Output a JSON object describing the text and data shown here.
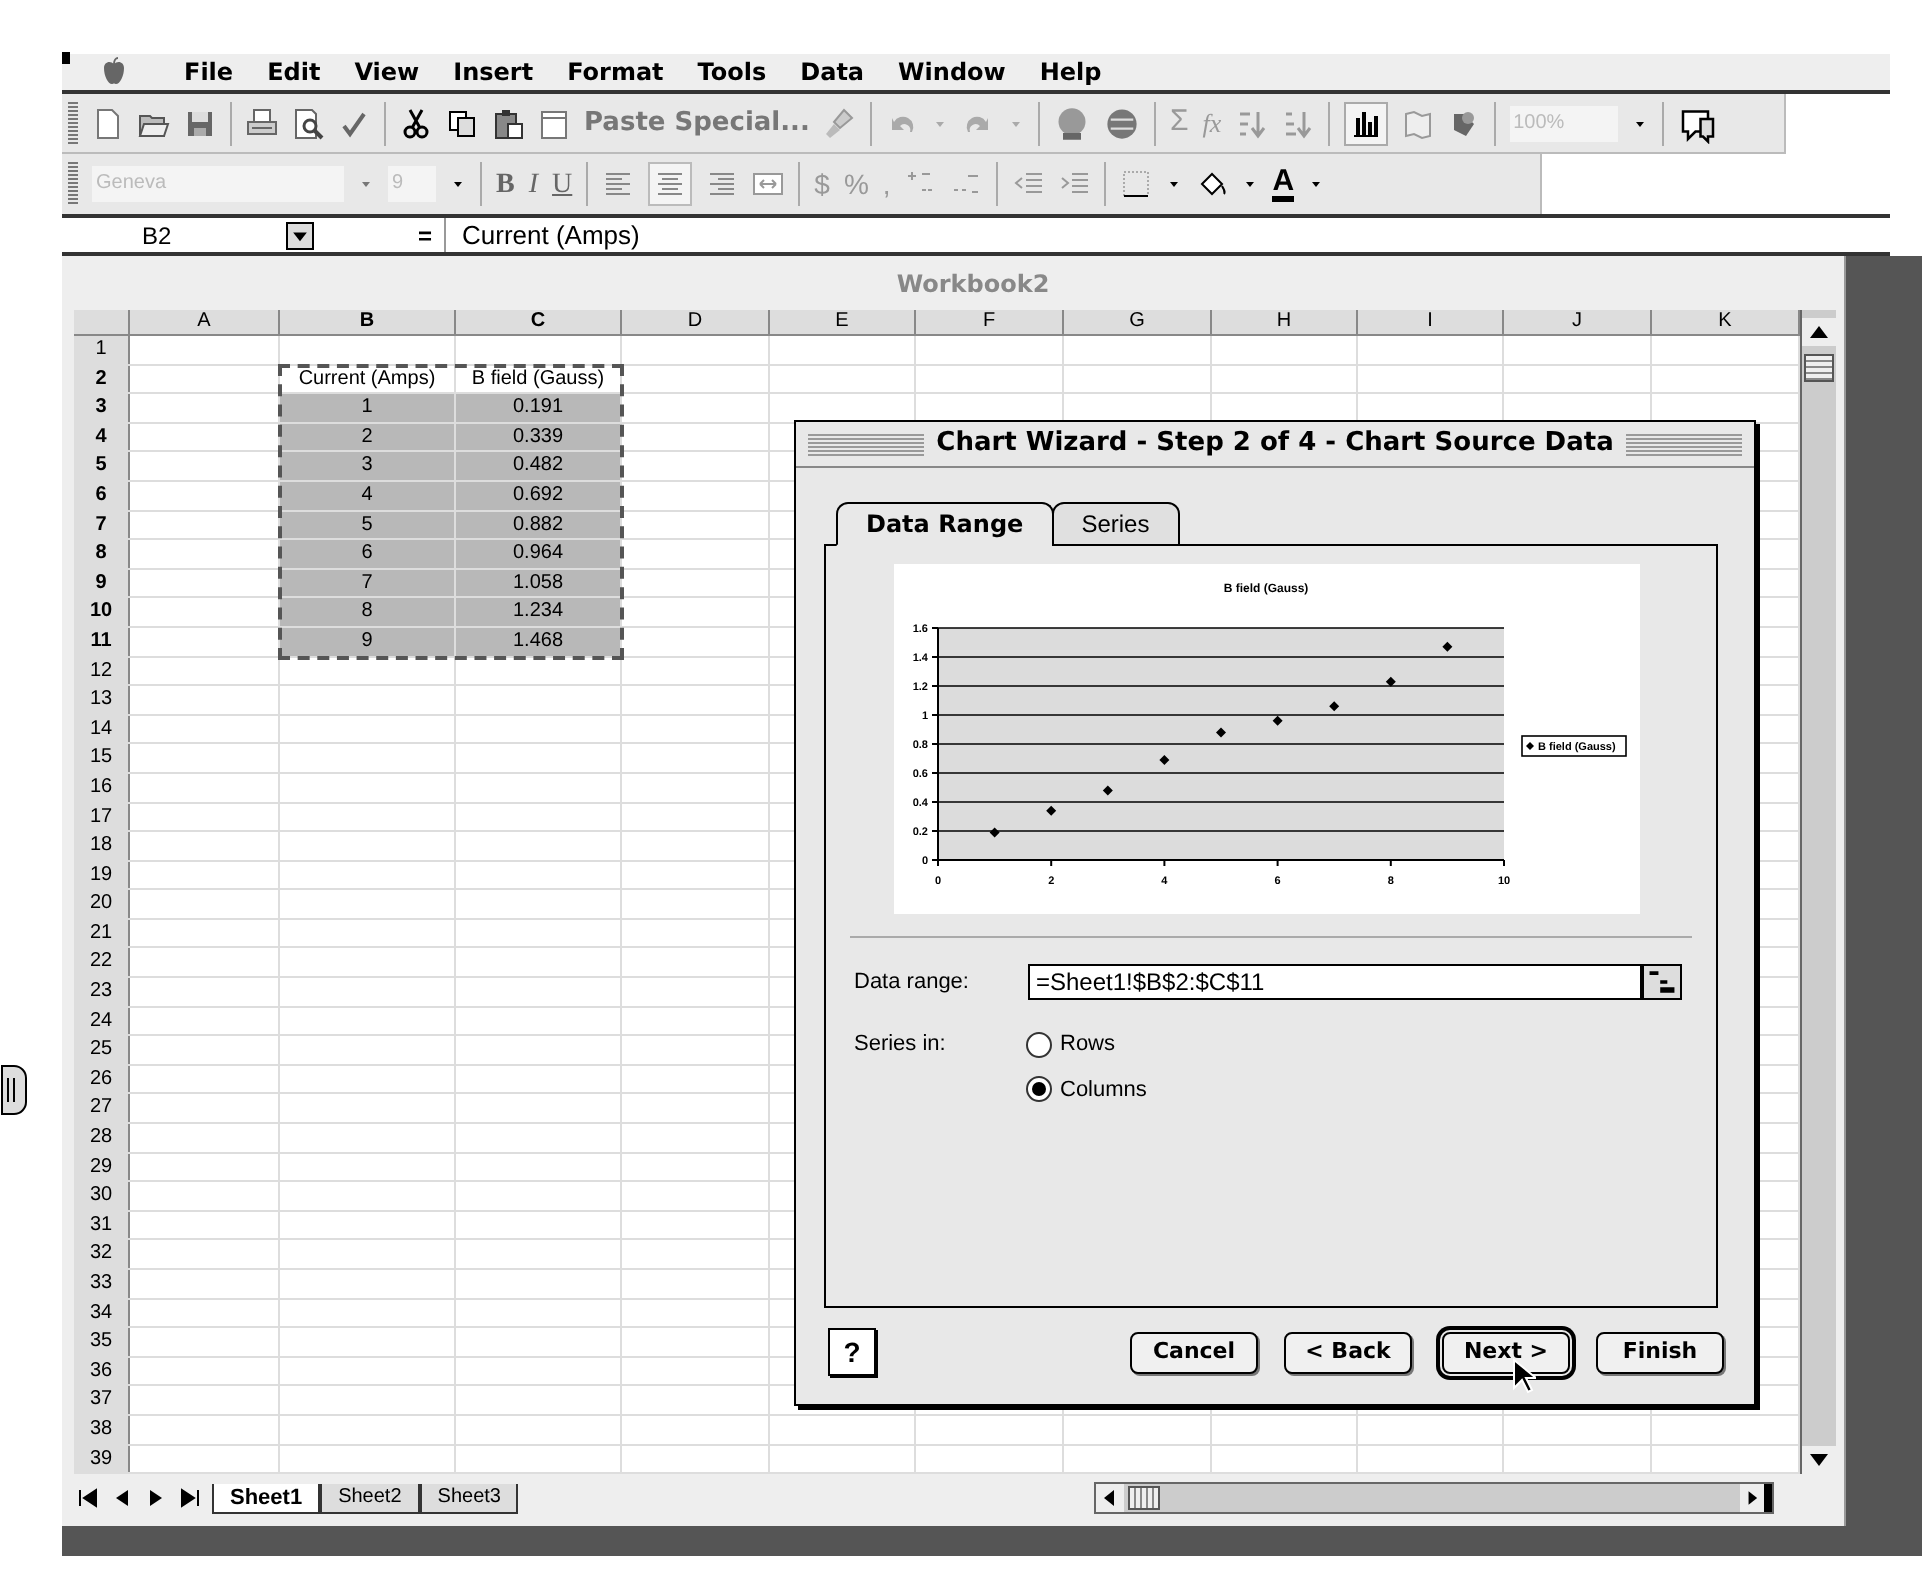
{
  "menu": [
    "File",
    "Edit",
    "View",
    "Insert",
    "Format",
    "Tools",
    "Data",
    "Window",
    "Help"
  ],
  "toolbar_standard": {
    "paste_special": "Paste Special...",
    "sum": "Σ",
    "function": "fx",
    "zoom": "100%"
  },
  "toolbar_formatting": {
    "font": "Geneva",
    "size": "9",
    "bold": "B",
    "italic": "I",
    "underline": "U",
    "currency": "$",
    "percent": "%",
    "comma": ",",
    "font_color": "A"
  },
  "formula_bar": {
    "name_box": "B2",
    "equals": "=",
    "value": "Current (Amps)"
  },
  "workbook": {
    "title": "Workbook2",
    "columns": [
      {
        "label": "A",
        "selected": false
      },
      {
        "label": "B",
        "selected": true
      },
      {
        "label": "C",
        "selected": true
      },
      {
        "label": "D",
        "selected": false
      },
      {
        "label": "E",
        "selected": false
      },
      {
        "label": "F",
        "selected": false
      },
      {
        "label": "G",
        "selected": false
      },
      {
        "label": "H",
        "selected": false
      },
      {
        "label": "I",
        "selected": false
      },
      {
        "label": "J",
        "selected": false
      },
      {
        "label": "K",
        "selected": false
      }
    ],
    "rows": [
      {
        "number": "1",
        "selected": false,
        "shaded": false
      },
      {
        "number": "2",
        "selected": true,
        "shaded": false,
        "column_b": "Current (Amps)",
        "column_c": "B field (Gauss)"
      },
      {
        "number": "3",
        "selected": true,
        "shaded": true,
        "column_b": "1",
        "column_c": "0.191"
      },
      {
        "number": "4",
        "selected": true,
        "shaded": true,
        "column_b": "2",
        "column_c": "0.339"
      },
      {
        "number": "5",
        "selected": true,
        "shaded": true,
        "column_b": "3",
        "column_c": "0.482"
      },
      {
        "number": "6",
        "selected": true,
        "shaded": true,
        "column_b": "4",
        "column_c": "0.692"
      },
      {
        "number": "7",
        "selected": true,
        "shaded": true,
        "column_b": "5",
        "column_c": "0.882"
      },
      {
        "number": "8",
        "selected": true,
        "shaded": true,
        "column_b": "6",
        "column_c": "0.964"
      },
      {
        "number": "9",
        "selected": true,
        "shaded": true,
        "column_b": "7",
        "column_c": "1.058"
      },
      {
        "number": "10",
        "selected": true,
        "shaded": true,
        "column_b": "8",
        "column_c": "1.234"
      },
      {
        "number": "11",
        "selected": true,
        "shaded": true,
        "column_b": "9",
        "column_c": "1.468"
      },
      {
        "number": "12",
        "selected": false,
        "shaded": false
      },
      {
        "number": "13",
        "selected": false,
        "shaded": false
      },
      {
        "number": "14",
        "selected": false,
        "shaded": false
      },
      {
        "number": "15",
        "selected": false,
        "shaded": false
      },
      {
        "number": "16",
        "selected": false,
        "shaded": false
      },
      {
        "number": "17",
        "selected": false,
        "shaded": false
      },
      {
        "number": "18",
        "selected": false,
        "shaded": false
      },
      {
        "number": "19",
        "selected": false,
        "shaded": false
      },
      {
        "number": "20",
        "selected": false,
        "shaded": false
      },
      {
        "number": "21",
        "selected": false,
        "shaded": false
      },
      {
        "number": "22",
        "selected": false,
        "shaded": false
      },
      {
        "number": "23",
        "selected": false,
        "shaded": false
      },
      {
        "number": "24",
        "selected": false,
        "shaded": false
      },
      {
        "number": "25",
        "selected": false,
        "shaded": false
      },
      {
        "number": "26",
        "selected": false,
        "shaded": false
      },
      {
        "number": "27",
        "selected": false,
        "shaded": false
      },
      {
        "number": "28",
        "selected": false,
        "shaded": false
      },
      {
        "number": "29",
        "selected": false,
        "shaded": false
      },
      {
        "number": "30",
        "selected": false,
        "shaded": false
      },
      {
        "number": "31",
        "selected": false,
        "shaded": false
      },
      {
        "number": "32",
        "selected": false,
        "shaded": false
      },
      {
        "number": "33",
        "selected": false,
        "shaded": false
      },
      {
        "number": "34",
        "selected": false,
        "shaded": false
      },
      {
        "number": "35",
        "selected": false,
        "shaded": false
      },
      {
        "number": "36",
        "selected": false,
        "shaded": false
      },
      {
        "number": "37",
        "selected": false,
        "shaded": false
      },
      {
        "number": "38",
        "selected": false,
        "shaded": false
      },
      {
        "number": "39",
        "selected": false,
        "shaded": false
      }
    ],
    "sheet_tabs": [
      {
        "label": "Sheet1",
        "selected": true
      },
      {
        "label": "Sheet2",
        "selected": false
      },
      {
        "label": "Sheet3",
        "selected": false
      }
    ]
  },
  "chart_wizard": {
    "title": "Chart Wizard - Step 2 of 4 - Chart Source Data",
    "tabs": [
      {
        "label": "Data Range",
        "selected": true
      },
      {
        "label": "Series",
        "selected": false
      }
    ],
    "preview": {
      "chart_data": {
        "type": "scatter",
        "title": "B field (Gauss)",
        "x": [
          1,
          2,
          3,
          4,
          5,
          6,
          7,
          8,
          9
        ],
        "series": [
          {
            "name": "B field (Gauss)",
            "color": "#000000",
            "values": [
              0.19,
              0.34,
              0.48,
              0.69,
              0.88,
              0.96,
              1.06,
              1.23,
              1.47
            ]
          }
        ],
        "xlim": [
          0,
          10
        ],
        "ylim": [
          0,
          1.6
        ],
        "grid": true,
        "xticks": [
          0,
          2,
          4,
          6,
          8,
          10
        ],
        "yticks": [
          0,
          0.2,
          0.4,
          0.6,
          0.8,
          1,
          1.2,
          1.4,
          1.6
        ]
      }
    },
    "data_range": {
      "label": "Data range:",
      "value": "=Sheet1!$B$2:$C$11"
    },
    "series_in": {
      "label": "Series in:",
      "options": [
        {
          "label": "Rows",
          "selected": false
        },
        {
          "label": "Columns",
          "selected": true
        }
      ]
    },
    "help_button": "?",
    "buttons": [
      {
        "label": "Cancel",
        "default": false
      },
      {
        "label": "< Back",
        "default": false
      },
      {
        "label": "Next >",
        "default": true
      },
      {
        "label": "Finish",
        "default": false
      }
    ]
  }
}
